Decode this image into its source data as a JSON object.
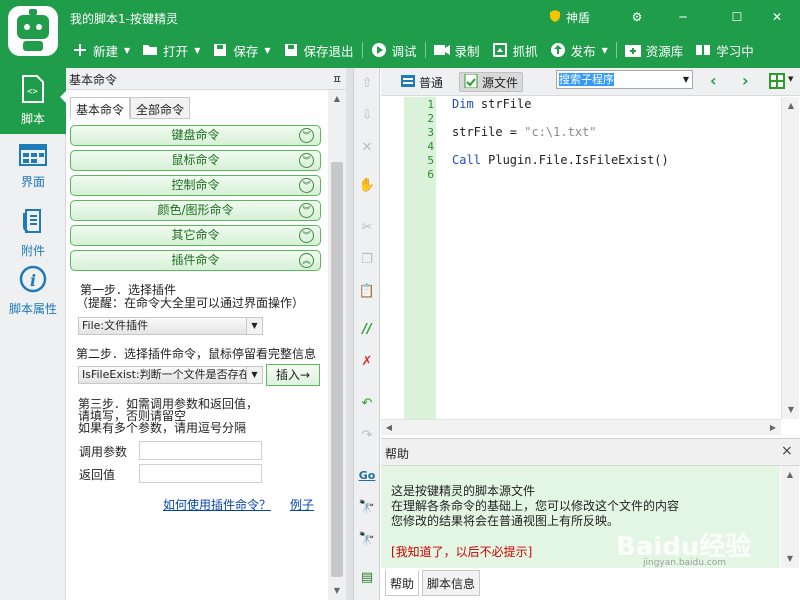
{
  "app": {
    "title": "我的脚本1-按键精灵",
    "shield_label": "神盾"
  },
  "toolbar": [
    {
      "label": "新建",
      "icon": "plus-icon",
      "dropdown": true
    },
    {
      "label": "打开",
      "icon": "folder-icon",
      "dropdown": true
    },
    {
      "label": "保存",
      "icon": "save-icon",
      "dropdown": true
    },
    {
      "label": "保存退出",
      "icon": "save-exit-icon",
      "dropdown": false
    },
    {
      "label": "调试",
      "icon": "play-icon",
      "dropdown": false
    },
    {
      "label": "录制",
      "icon": "record-icon",
      "dropdown": false
    },
    {
      "label": "抓抓",
      "icon": "capture-icon",
      "dropdown": false
    },
    {
      "label": "发布",
      "icon": "publish-icon",
      "dropdown": true
    },
    {
      "label": "资源库",
      "icon": "library-icon",
      "dropdown": false
    },
    {
      "label": "学习中",
      "icon": "learn-icon",
      "dropdown": false
    }
  ],
  "leftnav": [
    {
      "label": "脚本",
      "icon": "script-icon"
    },
    {
      "label": "界面",
      "icon": "ui-icon"
    },
    {
      "label": "附件",
      "icon": "attachment-icon"
    },
    {
      "label": "脚本属性",
      "icon": "info-icon"
    }
  ],
  "panel": {
    "title": "基本命令",
    "pin": "ㅍ",
    "tabs": [
      "基本命令",
      "全部命令"
    ],
    "categories": [
      "键盘命令",
      "鼠标命令",
      "控制命令",
      "颜色/图形命令",
      "其它命令",
      "插件命令"
    ],
    "step1_title": "第一步．选择插件",
    "step1_hint": "（提醒：在命令大全里可以通过界面操作）",
    "plugin_select": "File:文件插件",
    "step2": "第二步．选择插件命令，鼠标停留看完整信息",
    "command_select": "IsFileExist:判断一个文件是否存在",
    "insert_button": "插入→",
    "step3_lines": [
      "第三步．如需调用参数和返回值，",
      "请填写，否则请留空",
      "如果有多个参数，请用逗号分隔"
    ],
    "param_label": "调用参数",
    "param_value": "",
    "return_label": "返回值",
    "return_value": "",
    "link_howto": "如何使用插件命令？",
    "link_example": "例子"
  },
  "editor": {
    "view_normal": "普通",
    "view_source": "源文件",
    "sub_select": "搜索子程序",
    "line_numbers": [
      "1",
      "2",
      "3",
      "4",
      "5",
      "6"
    ],
    "code": {
      "l1_kw": "Dim",
      "l1_rest": " strFile",
      "l3_var": "strFile = ",
      "l3_str": "\"c:\\1.txt\"",
      "l5_kw": "Call",
      "l5_rest": " Plugin.File.IsFileExist()"
    }
  },
  "help": {
    "title": "帮助",
    "close": "×",
    "lines": [
      "这是按键精灵的脚本源文件",
      "在理解各条命令的基础上，您可以修改这个文件的内容",
      "您修改的结果将会在普通视图上有所反映。"
    ],
    "dismiss": "[我知道了，以后不必提示]",
    "tabs": [
      "帮助",
      "脚本信息"
    ]
  },
  "colors": {
    "brand_green": "#1f9d4a",
    "help_bg": "#e3f6e3",
    "link_red": "#d00000"
  },
  "watermark": {
    "main": "Baidu经验",
    "sub": "jingyan.baidu.com"
  }
}
